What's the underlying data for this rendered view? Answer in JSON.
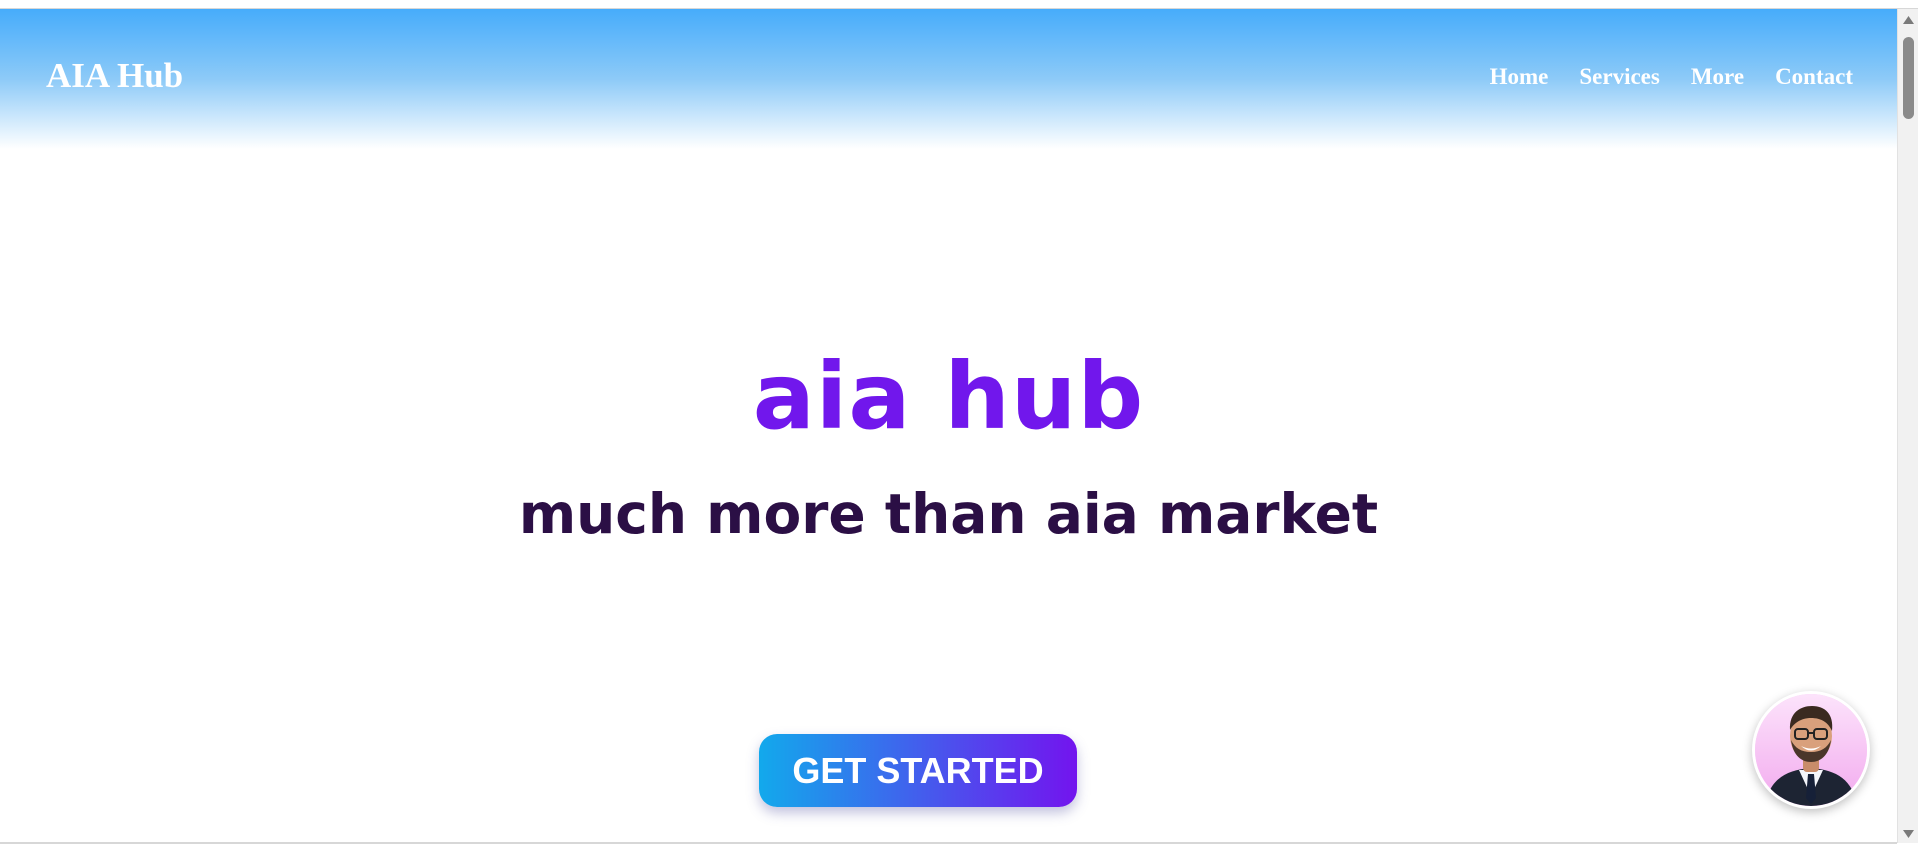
{
  "header": {
    "brand": "AIA Hub",
    "nav": [
      {
        "label": "Home"
      },
      {
        "label": "Services"
      },
      {
        "label": "More"
      },
      {
        "label": "Contact"
      }
    ]
  },
  "hero": {
    "title": "aia hub",
    "subtitle": "much more than aia market"
  },
  "cta": {
    "label": "GET STARTED"
  },
  "colors": {
    "header_gradient_top": "#46acfb",
    "title": "#7117ec",
    "subtitle": "#2b0f45",
    "cta_gradient_start": "#12a9ec",
    "cta_gradient_end": "#7314ee",
    "avatar_background": "#f8c4f4"
  },
  "icons": {
    "avatar": "person-avatar-icon",
    "scroll_up": "triangle-up-icon",
    "scroll_down": "triangle-down-icon"
  }
}
